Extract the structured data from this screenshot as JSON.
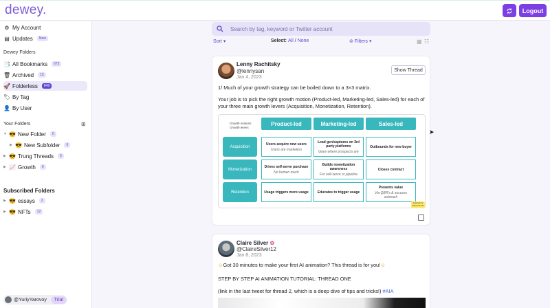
{
  "app": {
    "logo": "dewey.",
    "logout_label": "Logout"
  },
  "sidebar": {
    "my_account": "My Account",
    "updates": "Updates",
    "updates_badge": "New",
    "dewey_folders_heading": "Dewey Folders",
    "items": [
      {
        "label": "All Bookmarks",
        "badge": "673"
      },
      {
        "label": "Archived",
        "badge": "15"
      },
      {
        "label": "Folderless",
        "badge": "649"
      },
      {
        "label": "By Tag",
        "badge": ""
      },
      {
        "label": "By User",
        "badge": ""
      }
    ],
    "your_folders_heading": "Your Folders",
    "folders": [
      {
        "label": "New Folder",
        "badge": "0"
      },
      {
        "label": "New Subfolder",
        "badge": "0"
      },
      {
        "label": "Trung Threads",
        "badge": "6"
      },
      {
        "label": "Growth",
        "badge": "0"
      }
    ],
    "subscribed_heading": "Subscribed Folders",
    "subscribed": [
      {
        "label": "essays",
        "badge": "2"
      },
      {
        "label": "NFTs",
        "badge": "12"
      }
    ],
    "user": "@YuriyYarovoy",
    "trial": "Trial"
  },
  "main": {
    "search_placeholder": "Search by tag, keyword or Twitter account",
    "sort_label": "Sort",
    "select_label": "Select:",
    "select_all": "All",
    "select_sep": "/",
    "select_none": "None",
    "filters_label": "Filters"
  },
  "tweets": [
    {
      "name": "Lenny Rachitsky",
      "handle": "@lennysan",
      "date": "Jan 4, 2023",
      "show_thread": "Show Thread",
      "text1": "1/ Much of your growth strategy can be boiled down to a 3×3 matrix.",
      "text2": "Your job is to pick the right growth motion (Product-led, Marketing-led, Sales-led) for each of your three main growth levers (Acquisition, Monetization, Retention).",
      "matrix": {
        "corner": "Growth motions\nGrowth levers",
        "headers": [
          "Product-led",
          "Marketing-led",
          "Sales-led"
        ],
        "rows": [
          "Acquisition",
          "Monetization",
          "Retention"
        ],
        "cells": [
          [
            {
              "t": "Users acquire new users",
              "s": "Users are marketers"
            },
            {
              "t": "Lead gen/captures on 3rd party platforms",
              "s": "Goes where prospects are"
            },
            {
              "t": "Outbounds for new buyer",
              "s": ""
            }
          ],
          [
            {
              "t": "Drives self-serve purchase",
              "s": "No human touch"
            },
            {
              "t": "Builds monetization awareness",
              "s": "For self-serve or pipeline"
            },
            {
              "t": "Closes contract",
              "s": ""
            }
          ],
          [
            {
              "t": "Usage triggers more usage",
              "s": ""
            },
            {
              "t": "Educates to trigger usage",
              "s": ""
            },
            {
              "t": "Presents value",
              "s": "Via QBR's & success outreach"
            }
          ]
        ],
        "badge": "Inspired by Elena Verna"
      }
    },
    {
      "name": "Claire Silver",
      "handle": "@ClaireSilver12",
      "date": "Jan 8, 2023",
      "text1": "Got 30 minutes to make your first AI animation? This thread is for you!",
      "text2": "STEP BY STEP AI ANIMATION TUTORIAL: THREAD ONE",
      "text3": "(link in the last tweet for thread 2, which is a deep dive of tips and tricks!)",
      "hashtag": "#AIA"
    }
  ],
  "colors": {
    "accent": "#7b3fe4",
    "teal": "#38b7bd"
  }
}
